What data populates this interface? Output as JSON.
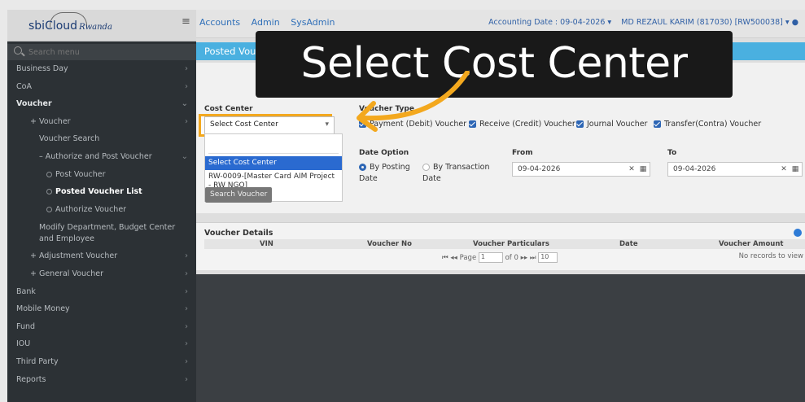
{
  "logo": {
    "brand": "sbiCloud",
    "region": "Rwanda"
  },
  "search": {
    "placeholder": "Search menu"
  },
  "sidebar": {
    "items": [
      {
        "label": "Business Day"
      },
      {
        "label": "CoA"
      },
      {
        "label": "Voucher"
      },
      {
        "label": "+ Voucher"
      },
      {
        "label": "Voucher Search"
      },
      {
        "label": "– Authorize and Post Voucher"
      },
      {
        "label": "Post Voucher"
      },
      {
        "label": "Posted Voucher List"
      },
      {
        "label": "Authorize Voucher"
      },
      {
        "label": "Modify Department, Budget Center and Employee"
      },
      {
        "label": "+ Adjustment Voucher"
      },
      {
        "label": "+ General Voucher"
      },
      {
        "label": "Bank"
      },
      {
        "label": "Mobile Money"
      },
      {
        "label": "Fund"
      },
      {
        "label": "IOU"
      },
      {
        "label": "Third Party"
      },
      {
        "label": "Reports"
      }
    ]
  },
  "topbar": {
    "links": [
      "Accounts",
      "Admin",
      "SysAdmin"
    ],
    "accounting_date": "Accounting Date : 09-04-2026",
    "user": "MD REZAUL KARIM (817030) [RW500038]"
  },
  "page": {
    "title": "Posted Voucher List"
  },
  "form": {
    "cost_center_label": "Cost Center",
    "cost_center_value": "Select Cost Center",
    "dropdown_options": [
      "Select Cost Center",
      "RW-0009-[Master Card AIM Project - RW NGO]"
    ],
    "voucher_type_label": "Voucher Type",
    "voucher_types": [
      "Payment (Debit) Voucher",
      "Receive (Credit) Voucher",
      "Journal Voucher",
      "Transfer(Contra) Voucher"
    ],
    "date_option_label": "Date Option",
    "date_options": [
      "By Posting Date",
      "By Transaction Date"
    ],
    "from_label": "From",
    "from_value": "09-04-2026",
    "to_label": "To",
    "to_value": "09-04-2026",
    "search_button": "Search Voucher"
  },
  "voucher_details": {
    "title": "Voucher Details",
    "columns": [
      "VIN",
      "Voucher No",
      "Voucher Particulars",
      "Date",
      "Voucher Amount"
    ],
    "pager": {
      "page_label": "Page",
      "page_value": "1",
      "of_label": "of 0",
      "page_size": "10"
    },
    "no_records": "No records to view"
  },
  "overlay": {
    "caption": "Select Cost Center"
  },
  "colors": {
    "accent": "#f3a81e",
    "title_bar": "#4ab0e0",
    "sidebar": "#2c3135",
    "link": "#2f6fb8"
  }
}
